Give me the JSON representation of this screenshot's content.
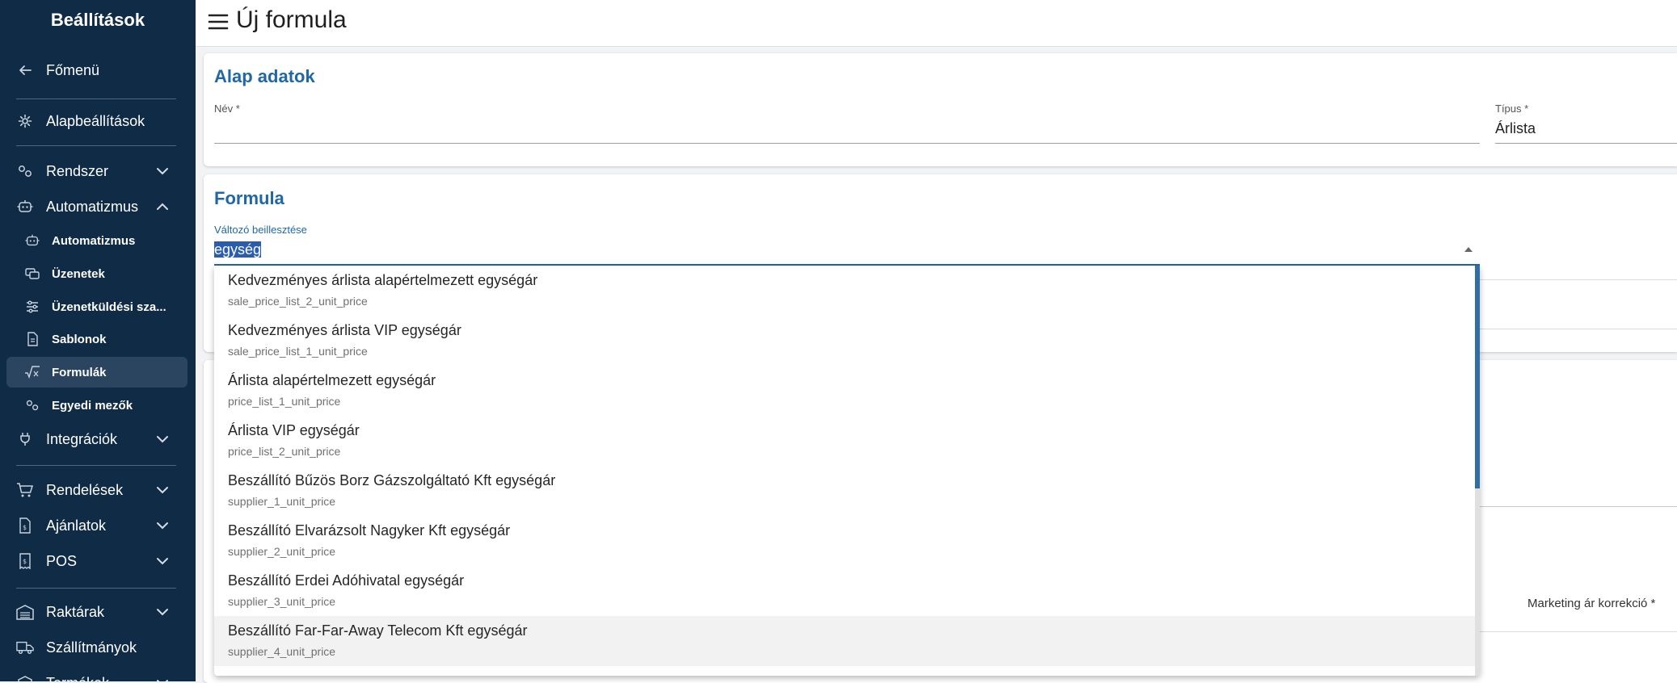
{
  "sidebar": {
    "title": "Beállítások",
    "back": {
      "label": "Főmenü",
      "icon": "arrow-left-icon"
    },
    "items": [
      {
        "label": "Alapbeállítások",
        "icon": "gear-icon"
      },
      {
        "label": "Rendszer",
        "icon": "cogs-icon",
        "expanded": false
      },
      {
        "label": "Automatizmus",
        "icon": "robot-icon",
        "expanded": true
      },
      {
        "label": "Integrációk",
        "icon": "plug-icon",
        "expanded": false
      },
      {
        "label": "Rendelések",
        "icon": "cart-icon",
        "expanded": false
      },
      {
        "label": "Ajánlatok",
        "icon": "document-dollar-icon",
        "expanded": false
      },
      {
        "label": "POS",
        "icon": "receipt-icon",
        "expanded": false
      },
      {
        "label": "Raktárak",
        "icon": "warehouse-icon",
        "expanded": false
      },
      {
        "label": "Szállítmányok",
        "icon": "truck-icon"
      },
      {
        "label": "Termékek",
        "icon": "box-icon",
        "expanded": false
      }
    ],
    "subitems": [
      {
        "label": "Automatizmus",
        "icon": "robot-icon"
      },
      {
        "label": "Üzenetek",
        "icon": "messages-icon"
      },
      {
        "label": "Üzenetküldési sza...",
        "icon": "sliders-icon"
      },
      {
        "label": "Sablonok",
        "icon": "file-icon"
      },
      {
        "label": "Formulák",
        "icon": "sqrt-x-icon",
        "active": true
      },
      {
        "label": "Egyedi mezők",
        "icon": "cogs-icon"
      }
    ]
  },
  "header": {
    "title": "Új formula",
    "menu_icon": "hamburger-icon"
  },
  "basic": {
    "title": "Alap adatok",
    "name_label": "Név *",
    "name_value": "",
    "type_label": "Típus *",
    "type_value": "Árlista"
  },
  "formula": {
    "title": "Formula",
    "insert_label": "Változó beillesztése",
    "insert_value": "egység",
    "dropdown_icon": "caret-up-icon"
  },
  "background": {
    "marketing_label": "Marketing ár korrekció *"
  },
  "colors": {
    "sidebar": "#0f2b46",
    "accent": "#1f67a6",
    "scrollbar": "#2f6fa6"
  },
  "options": [
    {
      "title": "Kedvezményes árlista alapértelmezett egységár",
      "sub": "sale_price_list_2_unit_price"
    },
    {
      "title": "Kedvezményes árlista VIP egységár",
      "sub": "sale_price_list_1_unit_price"
    },
    {
      "title": "Árlista alapértelmezett egységár",
      "sub": "price_list_1_unit_price"
    },
    {
      "title": "Árlista VIP egységár",
      "sub": "price_list_2_unit_price"
    },
    {
      "title": "Beszállító Bűzös Borz Gázszolgáltató Kft egységár",
      "sub": "supplier_1_unit_price"
    },
    {
      "title": "Beszállító Elvarázsolt Nagyker Kft egységár",
      "sub": "supplier_2_unit_price"
    },
    {
      "title": "Beszállító Erdei Adóhivatal egységár",
      "sub": "supplier_3_unit_price"
    },
    {
      "title": "Beszállító Far-Far-Away Telecom Kft egységár",
      "sub": "supplier_4_unit_price",
      "hover": true
    }
  ]
}
